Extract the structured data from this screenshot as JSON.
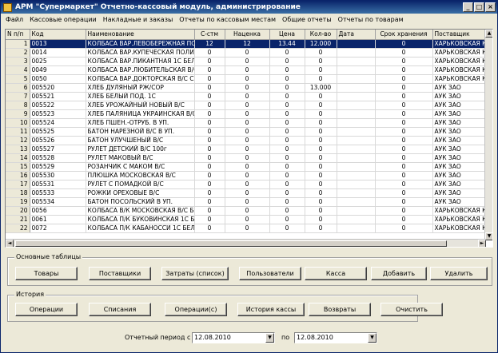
{
  "window": {
    "title": "АРМ \"Супермаркет\" Отчетно-кассовый модуль, администрирование",
    "buttons": {
      "minimize": "_",
      "maximize": "□",
      "close": "×"
    }
  },
  "menu": [
    "Файл",
    "Кассовые операции",
    "Накладные и заказы",
    "Отчеты по кассовым местам",
    "Общие отчеты",
    "Отчеты по товарам"
  ],
  "grid": {
    "columns": [
      "N п/п",
      "Код",
      "Наименование",
      "С-стм",
      "Наценка",
      "Цена",
      "Кол-во",
      "Дата",
      "Срок хранения",
      "Поставщик"
    ],
    "rows": [
      [
        "1",
        "0013",
        "КОЛБАСА ВАР.ЛЕВОБЕРЕЖНАЯ ПОЛИ",
        "12",
        "12",
        "13.44",
        "12.000",
        "",
        "0",
        "ХАРЬКОВСКАЯ К"
      ],
      [
        "2",
        "0014",
        "КОЛБАСА ВАР.КУПЕЧЕСКАЯ ПОЛИА",
        "0",
        "0",
        "0",
        "0",
        "",
        "0",
        "ХАРЬКОВСКАЯ К"
      ],
      [
        "3",
        "0025",
        "КОЛБАСА ВАР.ПИКАНТНАЯ 1С БЕЛК",
        "0",
        "0",
        "0",
        "0",
        "",
        "0",
        "ХАРЬКОВСКАЯ К"
      ],
      [
        "4",
        "0049",
        "КОЛБАСА ВАР.ЛЮБИТЕЛЬСКАЯ В/С",
        "0",
        "0",
        "0",
        "0",
        "",
        "0",
        "ХАРЬКОВСКАЯ К"
      ],
      [
        "5",
        "0050",
        "КОЛБАСА ВАР.ДОКТОРСКАЯ В/С СИ",
        "0",
        "0",
        "0",
        "0",
        "",
        "0",
        "ХАРЬКОВСКАЯ К"
      ],
      [
        "6",
        "005520",
        "ХЛЕБ ДУЛЯНЫЙ РЖ/СОР",
        "0",
        "0",
        "0",
        "13.000",
        "",
        "0",
        "АУК ЗАО"
      ],
      [
        "7",
        "005521",
        "ХЛЕБ БЕЛЫЙ ПОД. 1С",
        "0",
        "0",
        "0",
        "0",
        "",
        "0",
        "АУК ЗАО"
      ],
      [
        "8",
        "005522",
        "ХЛЕБ УРОЖАЙНЫЙ НОВЫЙ В/С",
        "0",
        "0",
        "0",
        "0",
        "",
        "0",
        "АУК ЗАО"
      ],
      [
        "9",
        "005523",
        "ХЛЕБ ПАЛЯНИЦА УКРАИНСКАЯ В/С",
        "0",
        "0",
        "0",
        "0",
        "",
        "0",
        "АУК ЗАО"
      ],
      [
        "10",
        "005524",
        "ХЛЕБ ПШЕН.-ОТРУБ. В УП.",
        "0",
        "0",
        "0",
        "0",
        "",
        "0",
        "АУК ЗАО"
      ],
      [
        "11",
        "005525",
        "БАТОН НАРЕЗНОЙ В/С В УП.",
        "0",
        "0",
        "0",
        "0",
        "",
        "0",
        "АУК ЗАО"
      ],
      [
        "12",
        "005526",
        "БАТОН УЛУЧШЕНЫЙ В/С",
        "0",
        "0",
        "0",
        "0",
        "",
        "0",
        "АУК ЗАО"
      ],
      [
        "13",
        "005527",
        "РУЛЕТ ДЕТСКИЙ В/С 100г",
        "0",
        "0",
        "0",
        "0",
        "",
        "0",
        "АУК ЗАО"
      ],
      [
        "14",
        "005528",
        "РУЛЕТ МАКОВЫЙ В/С",
        "0",
        "0",
        "0",
        "0",
        "",
        "0",
        "АУК ЗАО"
      ],
      [
        "15",
        "005529",
        "РОЗАНЧИК С МАКОМ В/С",
        "0",
        "0",
        "0",
        "0",
        "",
        "0",
        "АУК ЗАО"
      ],
      [
        "16",
        "005530",
        "ПЛЮШКА МОСКОВСКАЯ В/С",
        "0",
        "0",
        "0",
        "0",
        "",
        "0",
        "АУК ЗАО"
      ],
      [
        "17",
        "005531",
        "РУЛЕТ С ПОМАДКОЙ В/С",
        "0",
        "0",
        "0",
        "0",
        "",
        "0",
        "АУК ЗАО"
      ],
      [
        "18",
        "005533",
        "РОЖКИ ОРЕХОВЫЕ В/С",
        "0",
        "0",
        "0",
        "0",
        "",
        "0",
        "АУК ЗАО"
      ],
      [
        "19",
        "005534",
        "БАТОН ПОСОЛЬСКИЙ В УП.",
        "0",
        "0",
        "0",
        "0",
        "",
        "0",
        "АУК ЗАО"
      ],
      [
        "20",
        "0056",
        "КОЛБАСА В/К МОСКОВСКАЯ В/С БЕЛ",
        "0",
        "0",
        "0",
        "0",
        "",
        "0",
        "ХАРЬКОВСКАЯ К"
      ],
      [
        "21",
        "0061",
        "КОЛБАСА П/К БУКОВИНСКАЯ 1С БЕЛ",
        "0",
        "0",
        "0",
        "0",
        "",
        "0",
        "ХАРЬКОВСКАЯ К"
      ],
      [
        "22",
        "0072",
        "КОЛБАСА П/К КАБАНОССИ 1С БЕЛК",
        "0",
        "0",
        "0",
        "0",
        "",
        "0",
        "ХАРЬКОВСКАЯ К"
      ]
    ]
  },
  "main_tables": {
    "legend": "Основные таблицы",
    "buttons": [
      "Товары",
      "Поставщики",
      "Затраты (список)",
      "Пользователи",
      "Касса",
      "Добавить",
      "Удалить"
    ]
  },
  "history": {
    "legend": "История",
    "buttons": [
      "Операции",
      "Списания",
      "Операции(с)",
      "История кассы",
      "Возвраты",
      "Очистить"
    ]
  },
  "period": {
    "label": "Отчетный период с",
    "from": "12.08.2010",
    "to_label": "по",
    "to": "12.08.2010"
  }
}
